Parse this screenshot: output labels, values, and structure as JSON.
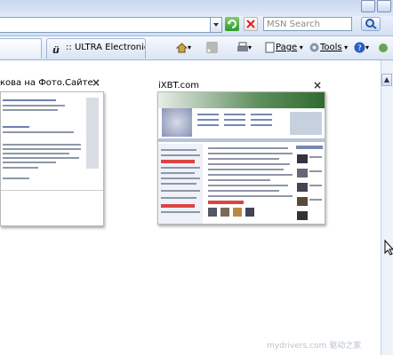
{
  "browser": {
    "search_placeholder": "MSN Search",
    "tabs": [
      {
        "label": ""
      },
      {
        "label": ":: ULTRA Electronic..."
      }
    ],
    "command_bar": {
      "page_label": "Page",
      "tools_label": "Tools"
    }
  },
  "quick_tabs": [
    {
      "title": "кова на Фото.Сайте"
    },
    {
      "title": "iXBT.com"
    }
  ],
  "watermark": "mydrivers.com 驱动之家",
  "colors": {
    "chrome": "#dbe5f4",
    "ixbt_header": "#3a7a3a"
  }
}
